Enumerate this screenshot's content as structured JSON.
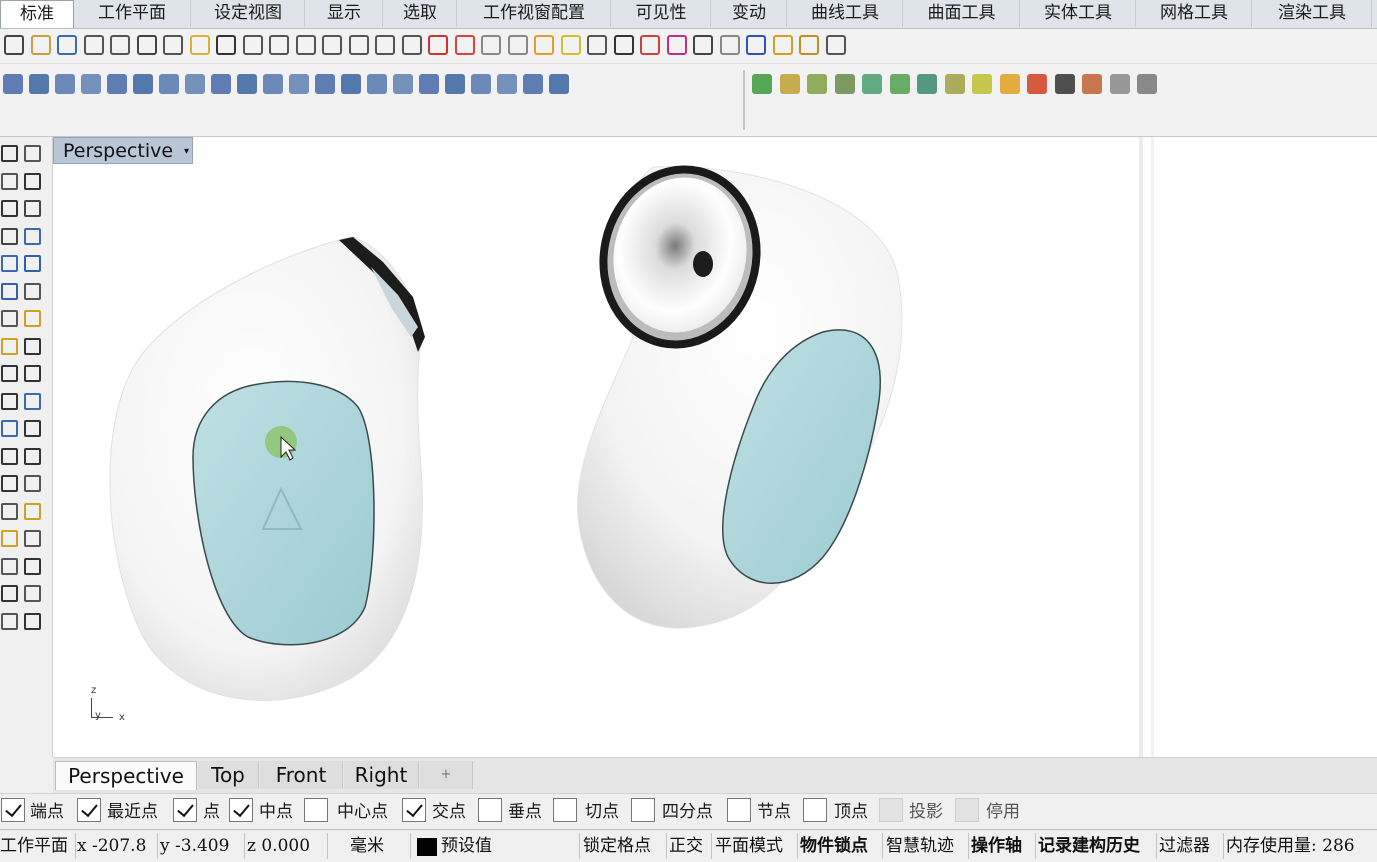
{
  "menu_tabs": [
    "标准",
    "工作平面",
    "设定视图",
    "显示",
    "选取",
    "工作视窗配置",
    "可见性",
    "变动",
    "曲线工具",
    "曲面工具",
    "实体工具",
    "网格工具",
    "渲染工具"
  ],
  "viewport": {
    "title": "Perspective",
    "axis_z": "z",
    "axis_y": "y",
    "axis_x": "x"
  },
  "viewport_tabs": [
    "Perspective",
    "Top",
    "Front",
    "Right"
  ],
  "viewport_tab_add": "+",
  "osnap": [
    {
      "label": "端点",
      "checked": true
    },
    {
      "label": "最近点",
      "checked": true
    },
    {
      "label": "点",
      "checked": true
    },
    {
      "label": "中点",
      "checked": true
    },
    {
      "label": "中心点",
      "checked": false
    },
    {
      "label": "交点",
      "checked": true
    },
    {
      "label": "垂点",
      "checked": false
    },
    {
      "label": "切点",
      "checked": false
    },
    {
      "label": "四分点",
      "checked": false
    },
    {
      "label": "节点",
      "checked": false
    },
    {
      "label": "顶点",
      "checked": false
    },
    {
      "label": "投影",
      "checked": false,
      "disabled": true
    },
    {
      "label": "停用",
      "checked": false,
      "disabled": true
    }
  ],
  "status": {
    "cplane": "工作平面",
    "x": "x -207.8",
    "y": "y -3.409",
    "z": "z 0.000",
    "units": "毫米",
    "layer": "预设值",
    "grid_snap": "锁定格点",
    "ortho": "正交",
    "planar": "平面模式",
    "osnap": "物件锁点",
    "smarttrack": "智慧轨迹",
    "gumball": "操作轴",
    "history": "记录建构历史",
    "filter": "过滤器",
    "memory": "内存使用量: 286"
  },
  "colors": {
    "accent_tab": "#b8c6d6",
    "model_body": "#ffffff",
    "model_pad": "#a9d2d7",
    "cursor_highlight": "#8cc46f"
  }
}
